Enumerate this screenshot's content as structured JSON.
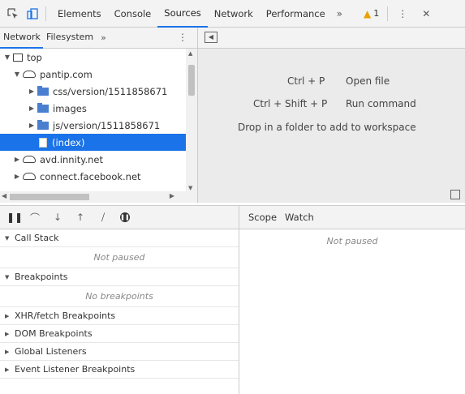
{
  "toolbar": {
    "tabs": [
      "Elements",
      "Console",
      "Sources",
      "Network",
      "Performance"
    ],
    "active_tab": "Sources",
    "more": "»",
    "warning_count": "1",
    "kebab": "⋮",
    "close": "✕"
  },
  "navigator": {
    "tabs": [
      "Network",
      "Filesystem"
    ],
    "more": "»",
    "kebab": "⋮"
  },
  "tree": {
    "top": "top",
    "domain": "pantip.com",
    "folders": [
      "css/version/1511858671",
      "images",
      "js/version/1511858671"
    ],
    "selected_file": "(index)",
    "others": [
      "avd.innity.net",
      "connect.facebook.net"
    ]
  },
  "editor": {
    "shortcut1": "Ctrl + P",
    "action1": "Open file",
    "shortcut2": "Ctrl + Shift + P",
    "action2": "Run command",
    "drop_hint": "Drop in a folder to add to workspace"
  },
  "debugger": {
    "call_stack": "Call Stack",
    "call_stack_status": "Not paused",
    "breakpoints": "Breakpoints",
    "breakpoints_status": "No breakpoints",
    "sections": [
      "XHR/fetch Breakpoints",
      "DOM Breakpoints",
      "Global Listeners",
      "Event Listener Breakpoints"
    ]
  },
  "scope": {
    "tabs": [
      "Scope",
      "Watch"
    ],
    "status": "Not paused"
  },
  "colors": {
    "accent": "#1a73e8",
    "folder": "#4a7fd0",
    "warning": "#e8a200"
  }
}
